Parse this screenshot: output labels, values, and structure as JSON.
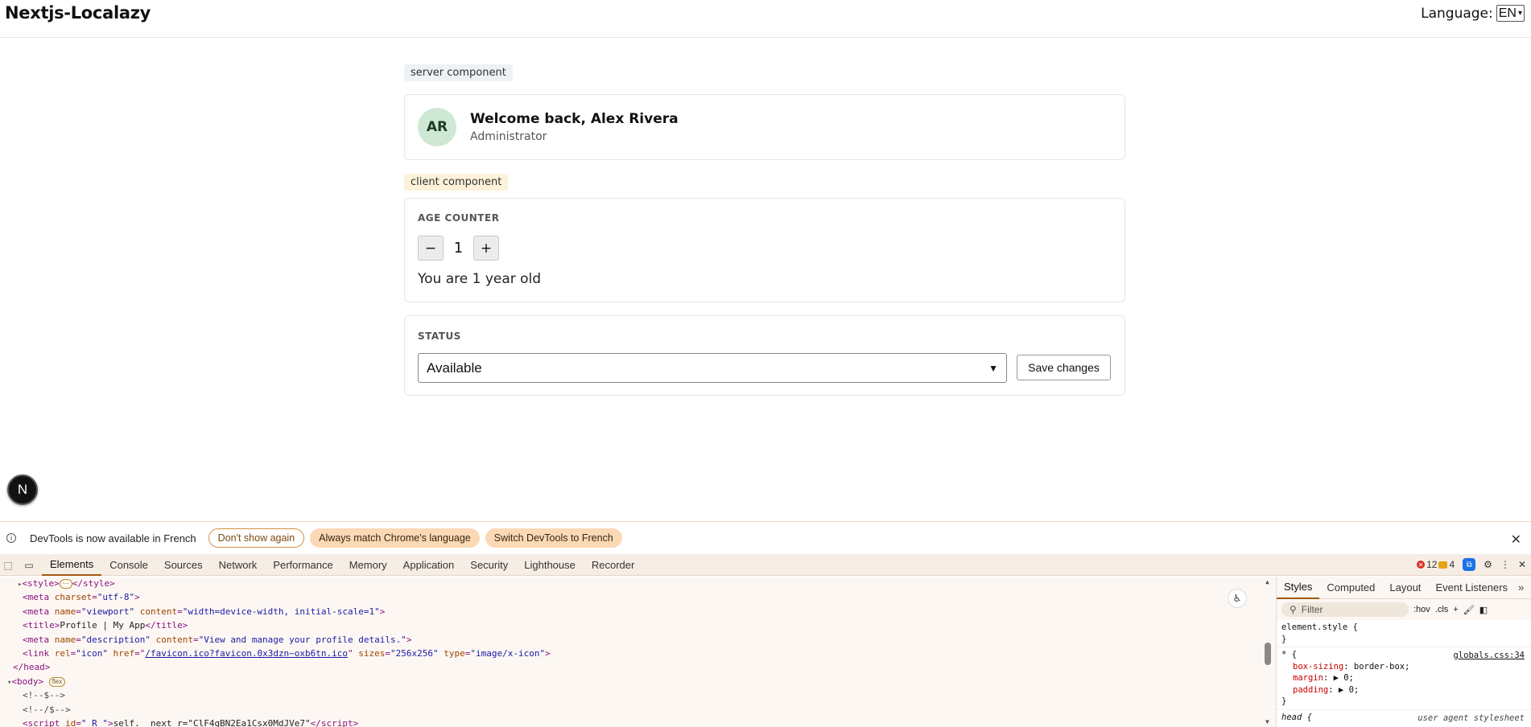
{
  "header": {
    "brand": "Nextjs-Localazy",
    "language_label": "Language:",
    "language_value": "EN"
  },
  "main": {
    "server_tag": "server component",
    "user": {
      "initials": "AR",
      "welcome": "Welcome back, Alex Rivera",
      "role": "Administrator"
    },
    "client_tag": "client component",
    "counter": {
      "label": "AGE COUNTER",
      "minus": "−",
      "value": "1",
      "plus": "+",
      "text": "You are 1 year old"
    },
    "status": {
      "label": "STATUS",
      "selected": "Available",
      "save_label": "Save changes"
    }
  },
  "next_badge": "N",
  "devtools": {
    "notice": {
      "text": "DevTools is now available in French",
      "dont_show": "Don't show again",
      "always_match": "Always match Chrome's language",
      "switch": "Switch DevTools to French"
    },
    "tabs": [
      "Elements",
      "Console",
      "Sources",
      "Network",
      "Performance",
      "Memory",
      "Application",
      "Security",
      "Lighthouse",
      "Recorder"
    ],
    "errors": "12",
    "warnings": "4",
    "code": {
      "style_open": "<style>",
      "style_ellipsis": "⋯",
      "style_close": "</style>",
      "meta_charset_val": "\"utf-8\"",
      "meta_viewport_val": "\"width=device-width, initial-scale=1\"",
      "title_text": "Profile | My App",
      "meta_desc_val": "\"View and manage your profile details.\"",
      "link_href": "/favicon.ico?favicon.0x3dzn~oxb6tn.ico",
      "link_sizes": "\"256x256\"",
      "link_type": "\"image/x-icon\"",
      "flex_badge": "flex",
      "comment1": "<!--$-->",
      "comment2": "<!--/$-->",
      "script_id": "\"_R_\"",
      "script_text": "self.__next_r=\"ClF4gBN2Ea1Csx0MdJVe7\""
    },
    "styles": {
      "tabs": [
        "Styles",
        "Computed",
        "Layout",
        "Event Listeners"
      ],
      "more": "»",
      "filter_placeholder": "Filter",
      "hov": ":hov",
      "cls": ".cls",
      "element_style": "element.style {",
      "close_brace": "}",
      "star_selector": "* {",
      "star_source": "globals.css:34",
      "prop1_name": "box-sizing",
      "prop1_val": "border-box;",
      "prop2_name": "margin",
      "prop2_val": "0;",
      "prop3_name": "padding",
      "prop3_val": "0;",
      "head_selector": "head {",
      "head_source": "user agent stylesheet"
    }
  },
  "colors": {
    "avatar_bg": "#cfe8d4",
    "server_tag_bg": "#eef1f5",
    "client_tag_bg": "#fbf2d9",
    "devtools_accent": "#a05a10",
    "pill_bg": "#fbd9b4"
  }
}
